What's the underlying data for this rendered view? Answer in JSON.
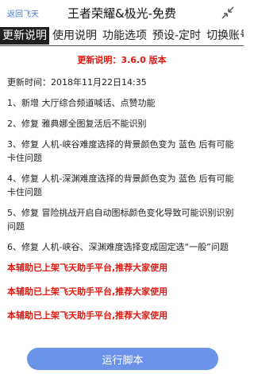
{
  "topbar": {
    "back_label": "返回飞天",
    "title": "王者荣耀&极光-免费"
  },
  "icons": {
    "collapse": "collapse-arrows-icon"
  },
  "tabs": [
    {
      "label": "更新说明",
      "active": true
    },
    {
      "label": "使用说明",
      "active": false
    },
    {
      "label": "功能选项",
      "active": false
    },
    {
      "label": "预设-定时",
      "active": false
    },
    {
      "label": "切换账号",
      "active": false
    }
  ],
  "content": {
    "version": "更新说明：3.6.0 版本",
    "update_time": "更新时间：2018年11月22日14:35",
    "notes": [
      "1、新增 大厅综合频道喊话、点赞功能",
      "2、修复 雅典娜全图复活后不能识别",
      "3、修复 人机-峡谷难度选择的背景颜色变为 蓝色 后有可能卡住问题",
      "4、修复 人机-深渊难度选择的背景颜色变为 蓝色 后有可能卡住问题",
      "5、修复 冒险挑战开启自动图标颜色变化导致可能识别识别问题",
      "6、修复 人机-峡谷、深渊难度选择变成固定选“一般”问题"
    ],
    "promo": [
      "本辅助已上架飞天助手平台,推荐大家使用",
      "本辅助已上架飞天助手平台,推荐大家使用",
      "本辅助已上架飞天助手平台,推荐大家使用"
    ]
  },
  "footer": {
    "run_label": "运行脚本"
  },
  "colors": {
    "accent": "#6b93e8",
    "highlight": "#e4160f",
    "link": "#4a78d6"
  }
}
